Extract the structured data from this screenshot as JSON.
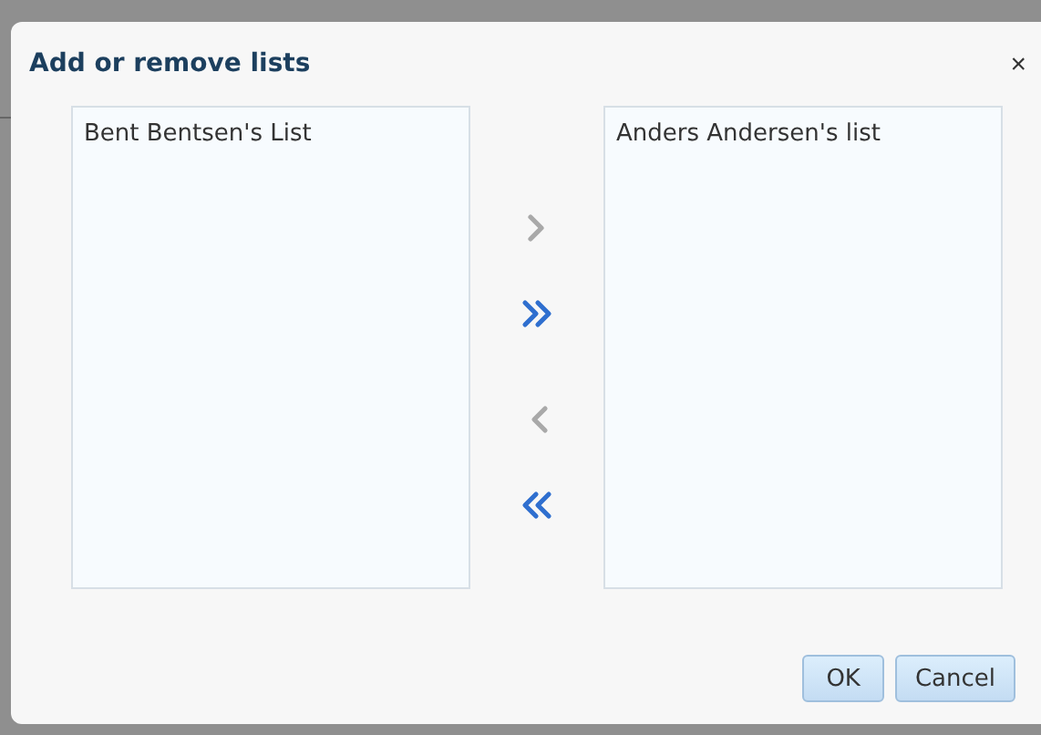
{
  "dialog": {
    "title": "Add or remove lists",
    "close": "×"
  },
  "available": {
    "items": [
      {
        "label": "Bent Bentsen's List",
        "selected": false
      }
    ]
  },
  "move_buttons": [
    {
      "kind": "right",
      "disabled": true
    },
    {
      "kind": "all-right",
      "disabled": false
    },
    {
      "kind": "left",
      "disabled": true
    },
    {
      "kind": "all-left",
      "disabled": false
    }
  ],
  "chosen": {
    "items": [
      {
        "label": "Anders Andersen's list",
        "selected": false
      }
    ]
  },
  "buttons": [
    {
      "label": "OK"
    },
    {
      "label": "Cancel"
    }
  ]
}
